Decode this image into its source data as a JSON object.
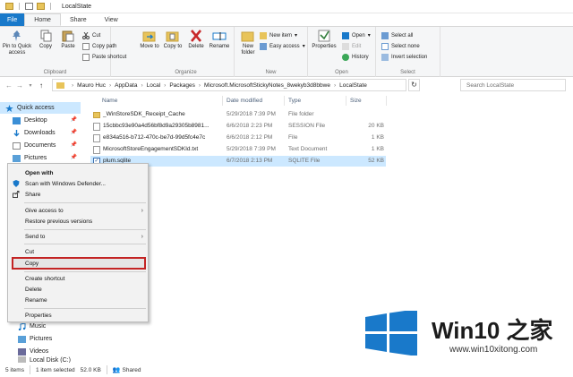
{
  "window": {
    "title": "LocalState"
  },
  "tabs": [
    "File",
    "Home",
    "Share",
    "View"
  ],
  "ribbon": {
    "clipboard": {
      "label": "Clipboard",
      "pin": "Pin to Quick access",
      "copy": "Copy",
      "paste": "Paste",
      "cut": "Cut",
      "copy_path": "Copy path",
      "paste_shortcut": "Paste shortcut"
    },
    "organize": {
      "label": "Organize",
      "move_to": "Move to",
      "copy_to": "Copy to",
      "delete": "Delete",
      "rename": "Rename"
    },
    "new": {
      "label": "New",
      "new_folder": "New folder",
      "new_item": "New item",
      "easy_access": "Easy access"
    },
    "open": {
      "label": "Open",
      "properties": "Properties",
      "open": "Open",
      "edit": "Edit",
      "history": "History"
    },
    "select": {
      "label": "Select",
      "select_all": "Select all",
      "select_none": "Select none",
      "invert": "Invert selection"
    }
  },
  "address": {
    "crumbs": [
      "Mauro Huc",
      "AppData",
      "Local",
      "Packages",
      "Microsoft.MicrosoftStickyNotes_8wekyb3d8bbwe",
      "LocalState"
    ],
    "search_placeholder": "Search LocalState"
  },
  "nav_pane": {
    "items": [
      "Quick access",
      "Desktop",
      "Downloads",
      "Documents",
      "Pictures"
    ],
    "lower_items": [
      "Music",
      "Pictures",
      "Videos",
      "Local Disk (C:)"
    ]
  },
  "columns": [
    "Name",
    "Date modified",
    "Type",
    "Size"
  ],
  "files": [
    {
      "name": "_WinStoreSDK_Receipt_Cache",
      "date": "5/29/2018 7:39 PM",
      "type": "File folder",
      "size": ""
    },
    {
      "name": "15cbbc93e90a4d56bf8d9a29305b8981...",
      "date": "6/6/2018 2:23 PM",
      "type": "SESSION File",
      "size": "20 KB"
    },
    {
      "name": "e834a516-b712-470c-be7d-99d5fc4e7c",
      "date": "6/6/2018 2:12 PM",
      "type": "File",
      "size": "1 KB"
    },
    {
      "name": "MicrosoftStoreEngagementSDKId.txt",
      "date": "5/29/2018 7:39 PM",
      "type": "Text Document",
      "size": "1 KB"
    },
    {
      "name": "plum.sqlite",
      "date": "6/7/2018 2:13 PM",
      "type": "SQLITE File",
      "size": "52 KB"
    }
  ],
  "context_menu": {
    "open_with": "Open with",
    "scan": "Scan with Windows Defender...",
    "share": "Share",
    "give_access": "Give access to",
    "restore": "Restore previous versions",
    "send_to": "Send to",
    "cut": "Cut",
    "copy": "Copy",
    "create_shortcut": "Create shortcut",
    "delete": "Delete",
    "rename": "Rename",
    "properties": "Properties"
  },
  "status": {
    "items": "5 items",
    "selected": "1 item selected",
    "size": "52.0 KB",
    "shared": "Shared"
  },
  "watermark": {
    "title": "Win10 之家",
    "url": "www.win10xitong.com"
  },
  "colors": {
    "accent": "#1979ca",
    "selection": "#cce8ff",
    "highlight_border": "#c32424"
  }
}
